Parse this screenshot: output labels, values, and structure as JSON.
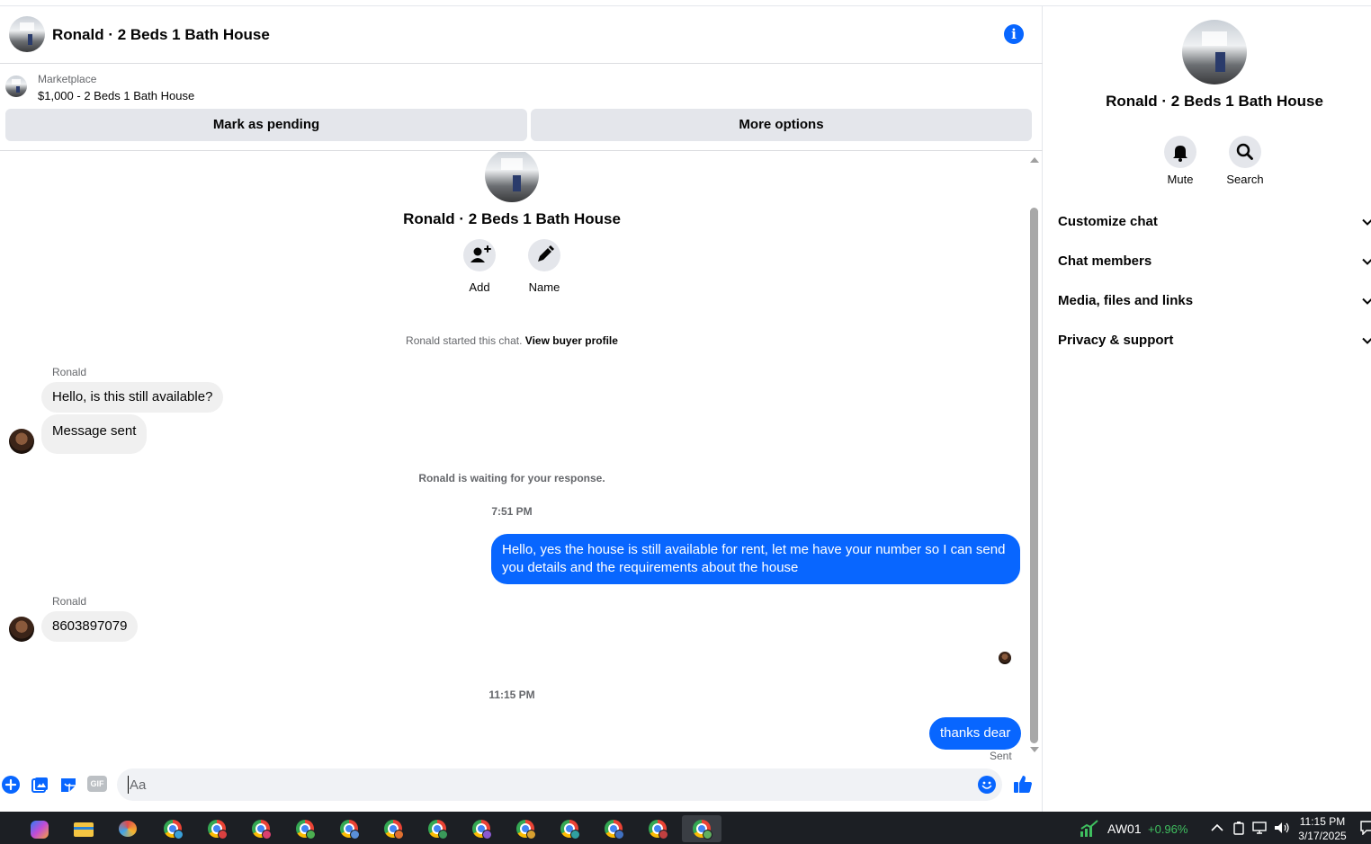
{
  "header": {
    "title": "Ronald · 2 Beds 1 Bath House"
  },
  "marketplace": {
    "label": "Marketplace",
    "listing": "$1,000 - 2 Beds 1 Bath House",
    "pending_button": "Mark as pending",
    "more_button": "More options"
  },
  "intro": {
    "title": "Ronald · 2 Beds 1 Bath House",
    "add_label": "Add",
    "name_label": "Name",
    "started_text": "Ronald started this chat.",
    "buyer_profile_link": "View buyer profile"
  },
  "messages": {
    "sender1": "Ronald",
    "msg1": "Hello, is this still available?",
    "msg2": "Message sent",
    "waiting": "Ronald is waiting for your response.",
    "time1": "7:51 PM",
    "out1": "Hello, yes the house is still available for rent, let me have your number so I can send you details and the requirements about the house",
    "sender2": "Ronald",
    "msg3": "8603897079",
    "time2": "11:15 PM",
    "out2": "thanks dear",
    "sent_status": "Sent"
  },
  "composer": {
    "placeholder": "Aa",
    "gif_label": "GIF"
  },
  "details": {
    "title": "Ronald · 2 Beds 1 Bath House",
    "mute_label": "Mute",
    "search_label": "Search",
    "sections": [
      "Customize chat",
      "Chat members",
      "Media, files and links",
      "Privacy & support"
    ]
  },
  "taskbar": {
    "ticker": "AW01",
    "ticker_change": "+0.96%",
    "time": "11:15 PM",
    "date": "3/17/2025"
  },
  "colors": {
    "accent": "#0866ff",
    "ticker_up": "#3fbf5f"
  },
  "icons": [
    "info-icon",
    "add-person-icon",
    "pencil-icon",
    "bell-icon",
    "search-icon",
    "chevron-down-icon",
    "plus-icon",
    "photo-icon",
    "sticker-icon",
    "gif-icon",
    "emoji-icon",
    "thumbs-up-icon",
    "chrome-icon"
  ]
}
